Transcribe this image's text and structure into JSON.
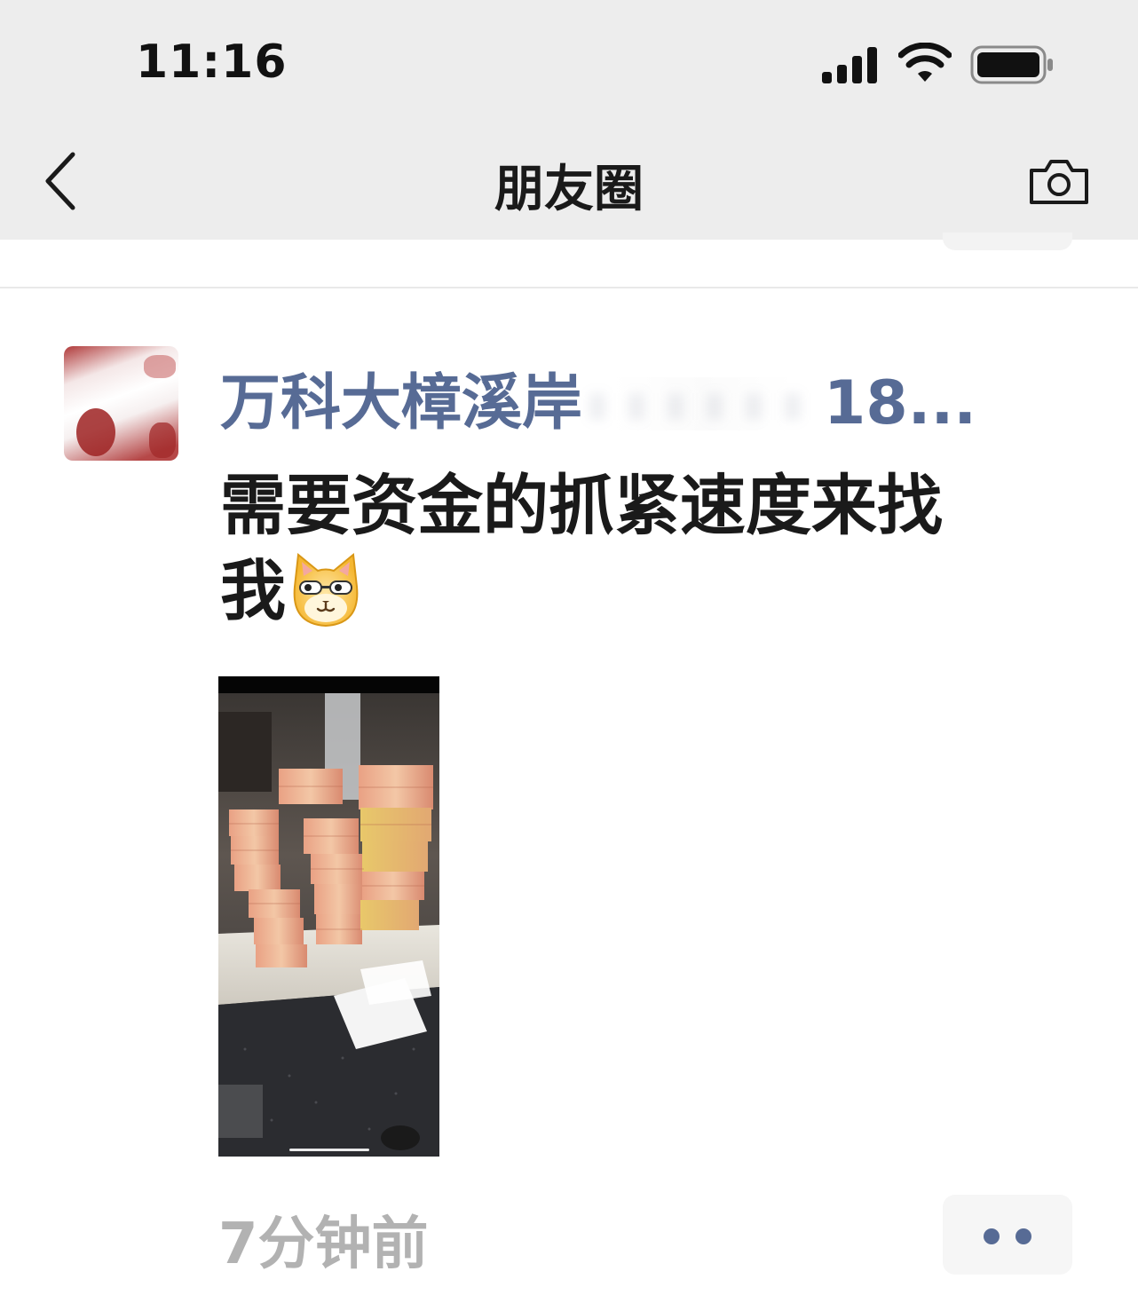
{
  "status_bar": {
    "time": "11:16",
    "signal_icon": "cellular-signal-icon",
    "wifi_icon": "wifi-icon",
    "battery_icon": "battery-icon"
  },
  "nav": {
    "title": "朋友圈",
    "back_icon": "chevron-left-icon",
    "camera_icon": "camera-icon"
  },
  "post": {
    "author_prefix": "万科大樟溪岸",
    "author_suffix": "18...",
    "text_line1": "需要资金的抓紧速度来找",
    "text_line2": "我",
    "emoji": "cat-face-emoji-icon",
    "image": "photo-stacks-of-banknotes",
    "timestamp": "7分钟前",
    "more_icon": "more-dots-icon"
  },
  "colors": {
    "nav_bg": "#ededed",
    "link_blue": "#576b95",
    "timestamp_gray": "#b2b2b2",
    "text": "#1a1a1a"
  }
}
